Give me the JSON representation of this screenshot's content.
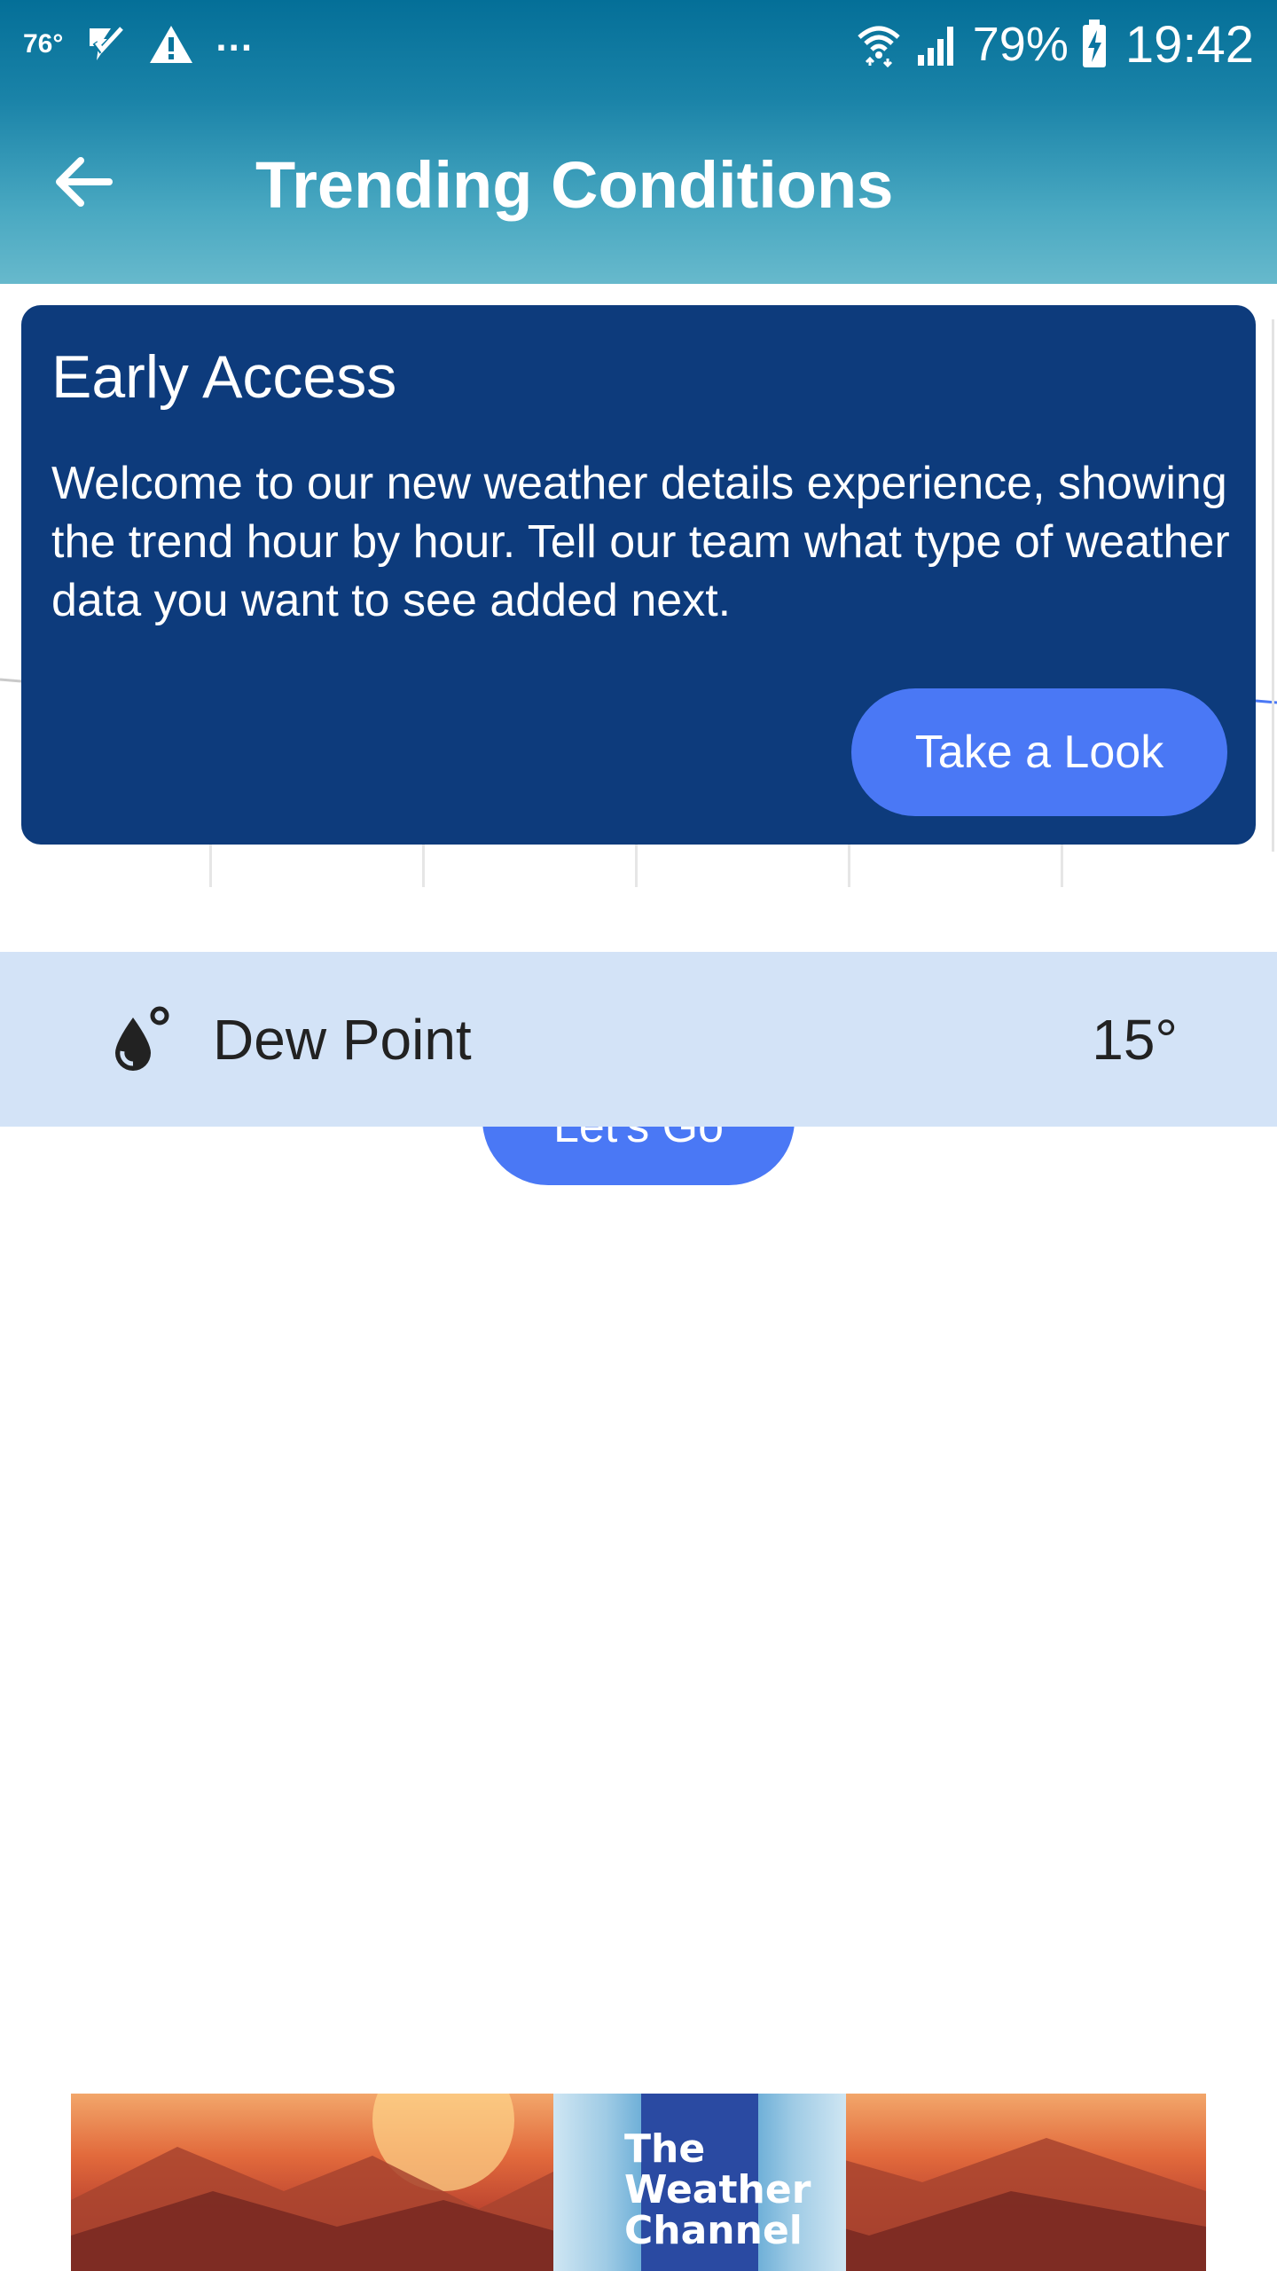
{
  "status_bar": {
    "temperature": "76°",
    "overflow": "...",
    "battery_percent": "79%",
    "time": "19:42",
    "icons": [
      "temp-notification",
      "check-notification-icon",
      "warning-icon",
      "wifi-icon",
      "signal-icon",
      "battery-charging-icon"
    ]
  },
  "app_bar": {
    "title": "Trending Conditions",
    "back_icon": "arrow-left-icon"
  },
  "early_access": {
    "title": "Early Access",
    "body": "Welcome to our new weather details experience, showing the trend hour by hour. Tell our team what type of weather data you want to see added next.",
    "button": "Take a Look"
  },
  "dew_point": {
    "icon": "dew-drop-icon",
    "label": "Dew Point",
    "value": "15°"
  },
  "lets_go": {
    "label": "Let's Go"
  },
  "ad": {
    "logo_text": "The Weather Channel"
  },
  "colors": {
    "header": "#046f98",
    "card": "#0d3b7c",
    "accent_button": "#4a78f5",
    "dew_row": "#d3e3f7"
  }
}
